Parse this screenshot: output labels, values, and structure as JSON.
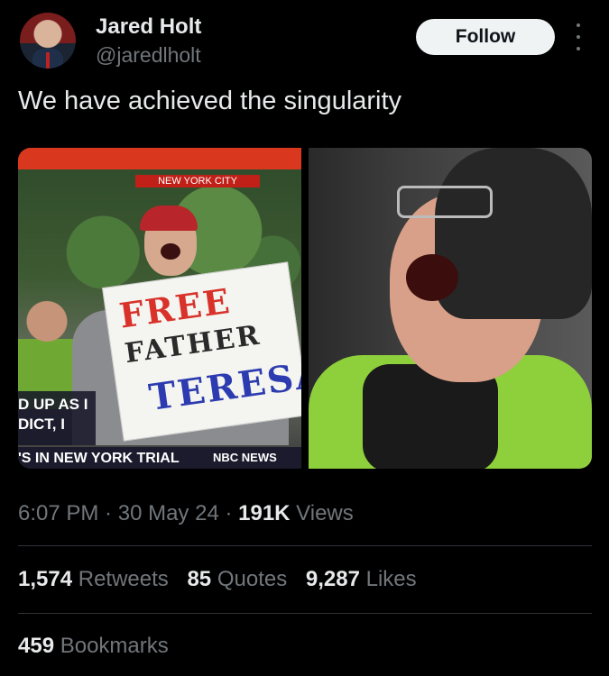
{
  "author": {
    "name": "Jared Holt",
    "handle": "@jaredlholt",
    "follow_label": "Follow"
  },
  "tweet": {
    "text": "We have achieved the singularity"
  },
  "media": {
    "left": {
      "location_label": "NEW YORK CITY",
      "sign_line1": "FREE",
      "sign_line2": "FATHER",
      "sign_line3": "TERESA",
      "ticker_line1": "D UP AS I",
      "ticker_line2": "DICT, I",
      "bottom_text": "'S IN NEW YORK TRIAL",
      "network": "NBC NEWS"
    }
  },
  "meta": {
    "time": "6:07 PM",
    "sep1": " · ",
    "date": "30 May 24",
    "sep2": " · ",
    "views_count": "191K",
    "views_label": " Views"
  },
  "stats": {
    "retweets_count": "1,574",
    "retweets_label": " Retweets",
    "quotes_count": "85",
    "quotes_label": " Quotes",
    "likes_count": "9,287",
    "likes_label": " Likes",
    "bookmarks_count": "459",
    "bookmarks_label": " Bookmarks"
  },
  "colors": {
    "background": "#000000",
    "text_primary": "#e7e9ea",
    "text_secondary": "#71767b",
    "follow_bg": "#eff3f4",
    "divider": "#2f3336"
  }
}
